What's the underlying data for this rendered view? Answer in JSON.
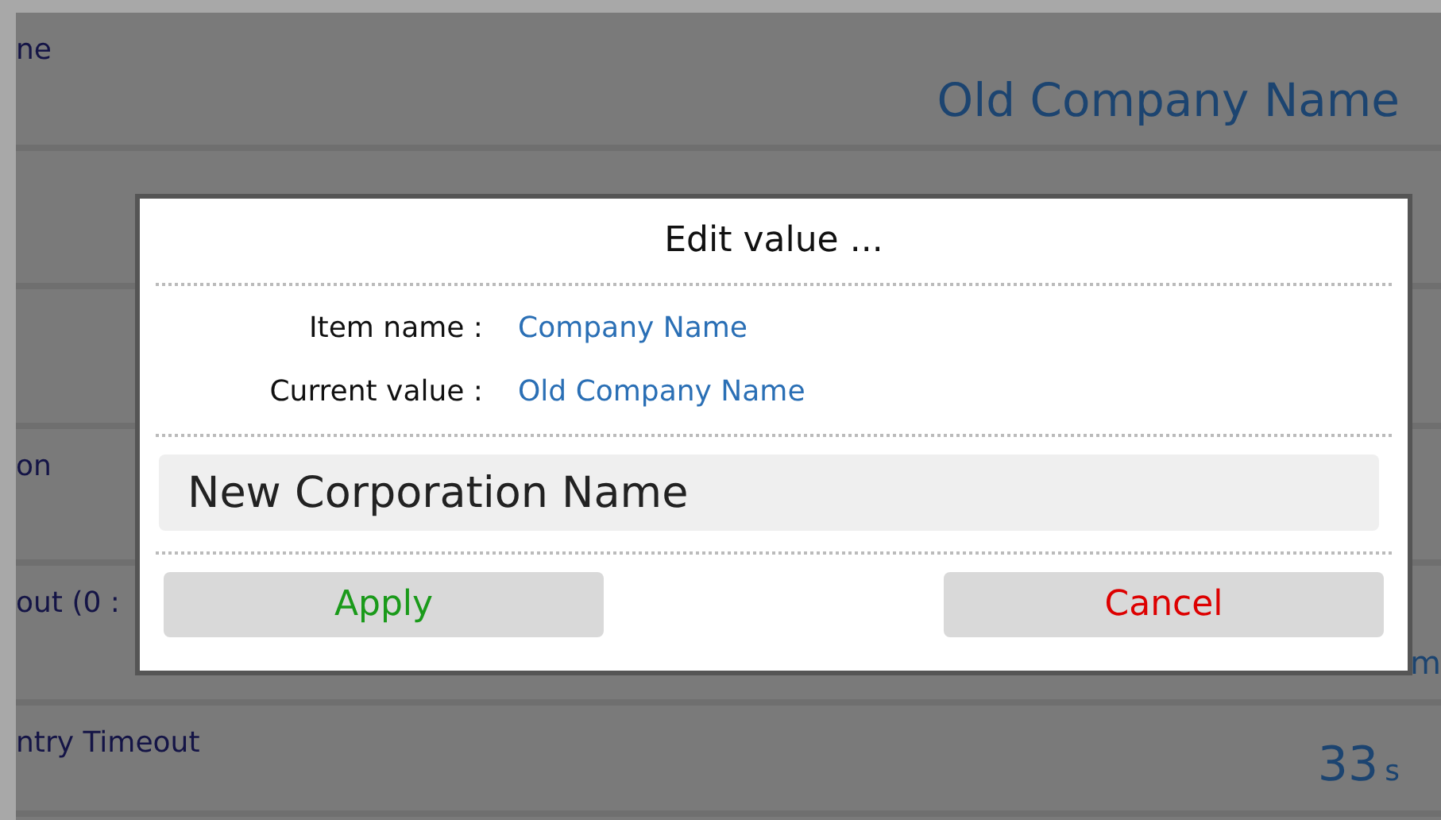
{
  "background_rows": [
    {
      "label": "ne",
      "value": "Old Company Name"
    },
    {
      "label": "",
      "value": ""
    },
    {
      "label": "",
      "value": ""
    },
    {
      "label": "on",
      "value": ""
    },
    {
      "label": "out (0 :",
      "value": "m"
    },
    {
      "label": "ntry Timeout",
      "value": "33",
      "unit": "s"
    }
  ],
  "dialog": {
    "title": "Edit value ...",
    "fields": [
      {
        "label": "Item name :",
        "value": "Company Name"
      },
      {
        "label": "Current value :",
        "value": "Old Company Name"
      }
    ],
    "input": {
      "value": "New Corporation Name"
    },
    "buttons": [
      {
        "label": "Apply",
        "kind": "confirm"
      },
      {
        "label": "Cancel",
        "kind": "cancel"
      }
    ]
  }
}
